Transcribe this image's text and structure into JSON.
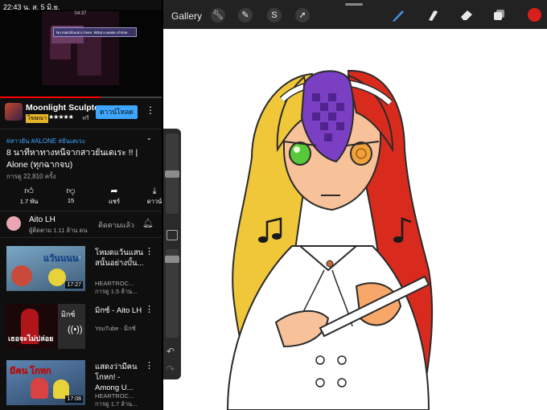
{
  "status": {
    "time_date": "22:43 น.  ส. 5 มิ.ย."
  },
  "player": {
    "game_time": "04:37",
    "game_dialog": "No matchbook in here. What a waste of time.",
    "progress_fraction": 0.62
  },
  "ad": {
    "title": "Moonlight Sculptor",
    "badge": "โฆษณา",
    "stars": "★★★★★",
    "free": "ฟรี",
    "button": "ดาวน์โหลด"
  },
  "video": {
    "tags": "#สาวยัน #ALONE #ยันเดเระ",
    "title": "8 นาทีหาทางหนีจากสาวยันเดเระ !! | Alone (ทุกฉากจบ)",
    "views": "การดู 22,810 ครั้ง",
    "actions": [
      {
        "label": "1.7 พัน",
        "icon": "like-icon"
      },
      {
        "label": "15",
        "icon": "dislike-icon"
      },
      {
        "label": "แชร์",
        "icon": "share-icon"
      },
      {
        "label": "ดาวน์",
        "icon": "download-icon"
      }
    ]
  },
  "channel": {
    "name": "Aito LH",
    "subs": "ผู้ติดตาม 1.11 ล้าน คน",
    "subscribed": "ติดตามแล้ว"
  },
  "recommended": [
    {
      "title": "โหมดแว้นแสนสนั้นอย่างบั้น...",
      "meta": "HEARTROC...\nการดู 1.5 ล้าน...",
      "duration": "17:27",
      "thumb_caption": "แว้นนนน!",
      "thumb_color": "#4e6f8c"
    },
    {
      "title": "มิกซ์ - Aito LH",
      "meta": "YouTube · มิกซ์",
      "duration": "",
      "thumb_caption": "เธอจะไม่ปล่อย",
      "thumb_color": "#240b0b"
    },
    {
      "title": "แสดงว่ามีคนโกหก! - Among U...",
      "meta": "HEARTROC...\nการดู 1.7 ล้าน...",
      "duration": "17:08",
      "thumb_caption": "มีคน โกหก",
      "thumb_color": "#3a5d8a"
    }
  ],
  "drawing_app": {
    "gallery": "Gallery",
    "tools": [
      "wrench-icon",
      "wand-icon",
      "selection-icon",
      "transform-icon"
    ],
    "active_color": "#d91e1e"
  }
}
